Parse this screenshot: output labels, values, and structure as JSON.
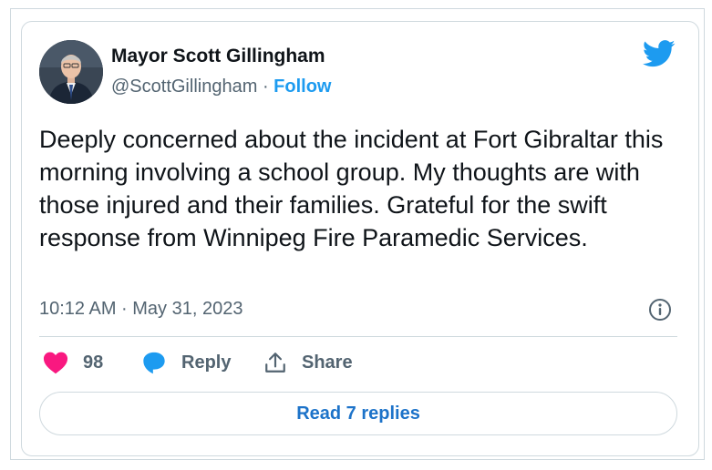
{
  "tweet": {
    "author_name": "Mayor Scott Gillingham",
    "handle": "@ScottGillingham",
    "separator": "·",
    "follow_label": "Follow",
    "text": "Deeply concerned about the incident at Fort Gibraltar this morning involving a school group. My thoughts are with those injured and their families. Grateful for the swift response from Winnipeg Fire Paramedic Services.",
    "timestamp": "10:12 AM · May 31, 2023"
  },
  "actions": {
    "like_count": "98",
    "reply_label": "Reply",
    "share_label": "Share"
  },
  "read_replies_label": "Read 7 replies",
  "icons": [
    "avatar",
    "twitter-bird-icon",
    "info-icon",
    "heart-icon",
    "reply-bubble-icon",
    "share-icon"
  ],
  "colors": {
    "brand_blue": "#1d9bf0",
    "like_pink": "#f91880",
    "text_primary": "#0f1419",
    "text_secondary": "#536471",
    "border": "#cfd9de"
  }
}
